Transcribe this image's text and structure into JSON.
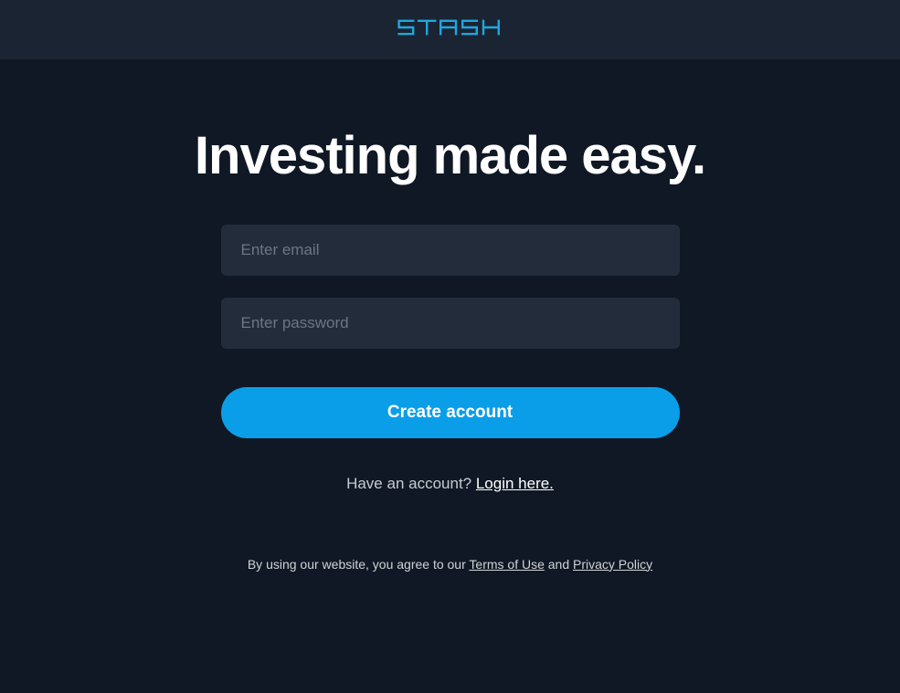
{
  "header": {
    "logo_text": "STASH"
  },
  "main": {
    "headline": "Investing made easy."
  },
  "form": {
    "email_placeholder": "Enter email",
    "email_value": "",
    "password_placeholder": "Enter password",
    "password_value": "",
    "submit_label": "Create account"
  },
  "login_prompt": {
    "text": "Have an account? ",
    "link_text": "Login here."
  },
  "legal": {
    "prefix": "By using our website, you agree to our ",
    "terms_label": "Terms of Use",
    "conjunction": " and ",
    "privacy_label": "Privacy Policy"
  },
  "colors": {
    "brand": "#1ea7e0",
    "button": "#0b9ee8",
    "background": "#0f1824",
    "header_bg": "#1a2432",
    "input_bg": "#232c3a"
  }
}
